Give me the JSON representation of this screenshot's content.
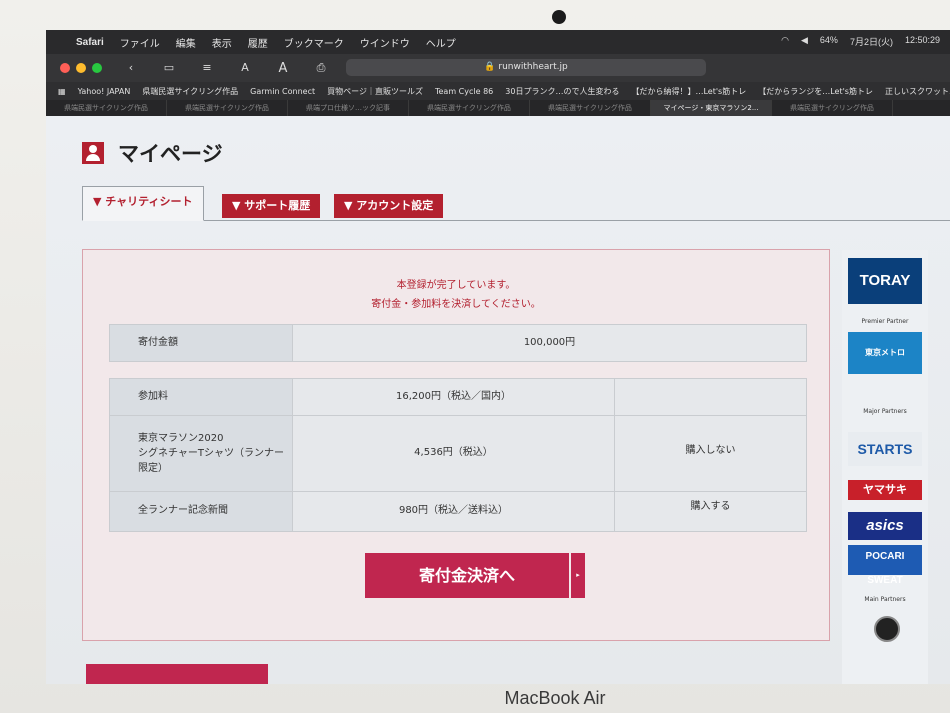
{
  "device": {
    "brand": "MacBook Air"
  },
  "menubar": {
    "app": "Safari",
    "items": [
      "ファイル",
      "編集",
      "表示",
      "履歴",
      "ブックマーク",
      "ウインドウ",
      "ヘルプ"
    ],
    "battery": "64%",
    "date": "7月2日(火)",
    "time": "12:50:29"
  },
  "toolbar": {
    "url": "runwithheart.jp",
    "text_small": "A",
    "text_large": "A"
  },
  "bookmarks": [
    "Yahoo! JAPAN",
    "県端民選サイクリング作品",
    "Garmin Connect",
    "買物ページ｜直販ツールズ",
    "Team Cycle 86",
    "30日プランク…ので人生変わる",
    "【だから納得！】…Let's筋トレ",
    "【だからランジを…Let's筋トレ",
    "正しいスクワット…Let's筋トレ"
  ],
  "tabs": {
    "items": [
      "県端民選サイクリング作品",
      "県端民選サイクリング作品",
      "県端プロ仕様ソ…ック記事",
      "県端民選サイクリング作品",
      "県端民選サイクリング作品",
      "マイページ・東京マラソン2...",
      "県端民選サイクリング作品"
    ],
    "active_index": 5
  },
  "page": {
    "title": "マイページ",
    "tabs": [
      "チャリティシート",
      "サポート履歴",
      "アカウント設定"
    ],
    "message": [
      "本登録が完了しています。",
      "寄付金・参加料を決済してください。"
    ],
    "donation": {
      "label": "寄付金額",
      "value": "100,000円"
    },
    "fees": [
      {
        "label": "参加料",
        "price": "16,200円（税込／国内）",
        "option": ""
      },
      {
        "label": "東京マラソン2020\nシグネチャーTシャツ（ランナー限定）",
        "price": "4,536円（税込）",
        "option": "購入しない"
      },
      {
        "label": "全ランナー記念新聞",
        "price": "980円（税込／送料込）",
        "option": "購入する"
      }
    ],
    "pay_button": "寄付金決済へ"
  },
  "sponsors": {
    "top": "TORAY",
    "premier_label": "Premier Partner",
    "premier": "東京メトロ",
    "major_label": "Major Partners",
    "major": [
      "STARTS",
      "ヤマサキ",
      "asics",
      "POCARI SWEAT"
    ],
    "main_label": "Main Partners",
    "main": "BMW"
  },
  "colors": {
    "accent": "#b3202f",
    "button": "#c0264f"
  }
}
